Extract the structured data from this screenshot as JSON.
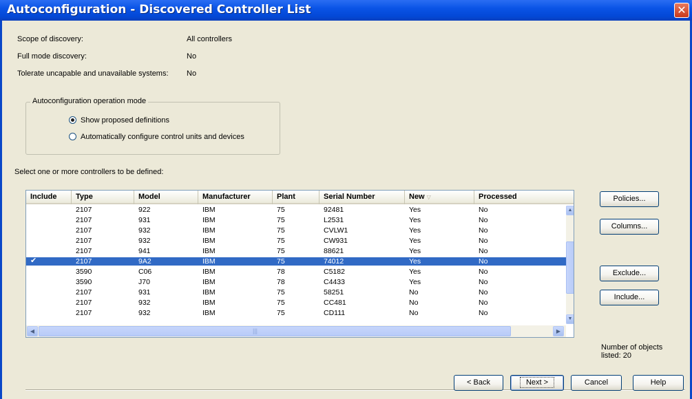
{
  "window": {
    "title": "Autoconfiguration - Discovered Controller List",
    "close_glyph": "✕"
  },
  "info": [
    {
      "label": "Scope of discovery:",
      "value": "All controllers"
    },
    {
      "label": "Full mode discovery:",
      "value": "No"
    },
    {
      "label": "Tolerate uncapable and unavailable systems:",
      "value": "No"
    }
  ],
  "mode_group": {
    "legend": "Autoconfiguration operation mode",
    "options": [
      {
        "label": "Show proposed definitions",
        "selected": true
      },
      {
        "label": "Automatically configure control units and devices",
        "selected": false
      }
    ]
  },
  "select_label": "Select one or more controllers to be defined:",
  "table": {
    "columns": [
      "Include",
      "Type",
      "Model",
      "Manufacturer",
      "Plant",
      "Serial Number",
      "New",
      "Processed"
    ],
    "sorted_column": "New",
    "rows": [
      {
        "include": "",
        "type": "2107",
        "model": "922",
        "manufacturer": "IBM",
        "plant": "75",
        "serial": "92481",
        "new": "Yes",
        "processed": "No"
      },
      {
        "include": "",
        "type": "2107",
        "model": "931",
        "manufacturer": "IBM",
        "plant": "75",
        "serial": "L2531",
        "new": "Yes",
        "processed": "No"
      },
      {
        "include": "",
        "type": "2107",
        "model": "932",
        "manufacturer": "IBM",
        "plant": "75",
        "serial": "CVLW1",
        "new": "Yes",
        "processed": "No"
      },
      {
        "include": "",
        "type": "2107",
        "model": "932",
        "manufacturer": "IBM",
        "plant": "75",
        "serial": "CW931",
        "new": "Yes",
        "processed": "No"
      },
      {
        "include": "",
        "type": "2107",
        "model": "941",
        "manufacturer": "IBM",
        "plant": "75",
        "serial": "88621",
        "new": "Yes",
        "processed": "No"
      },
      {
        "include": "✔",
        "type": "2107",
        "model": "9A2",
        "manufacturer": "IBM",
        "plant": "75",
        "serial": "74012",
        "new": "Yes",
        "processed": "No",
        "selected": true
      },
      {
        "include": "",
        "type": "3590",
        "model": "C06",
        "manufacturer": "IBM",
        "plant": "78",
        "serial": "C5182",
        "new": "Yes",
        "processed": "No"
      },
      {
        "include": "",
        "type": "3590",
        "model": "J70",
        "manufacturer": "IBM",
        "plant": "78",
        "serial": "C4433",
        "new": "Yes",
        "processed": "No"
      },
      {
        "include": "",
        "type": "2107",
        "model": "931",
        "manufacturer": "IBM",
        "plant": "75",
        "serial": "58251",
        "new": "No",
        "processed": "No"
      },
      {
        "include": "",
        "type": "2107",
        "model": "932",
        "manufacturer": "IBM",
        "plant": "75",
        "serial": "CC481",
        "new": "No",
        "processed": "No"
      },
      {
        "include": "",
        "type": "2107",
        "model": "932",
        "manufacturer": "IBM",
        "plant": "75",
        "serial": "CD111",
        "new": "No",
        "processed": "No"
      }
    ]
  },
  "side_buttons": {
    "policies": "Policies...",
    "columns": "Columns...",
    "exclude": "Exclude...",
    "include": "Include..."
  },
  "count_text": "Number of objects listed: 20",
  "footer": {
    "back": "< Back",
    "next": "Next >",
    "cancel": "Cancel",
    "help": "Help"
  },
  "colors": {
    "title_bar": "#0a54e6",
    "selection": "#316ac5",
    "dialog_bg": "#ece9d8"
  }
}
